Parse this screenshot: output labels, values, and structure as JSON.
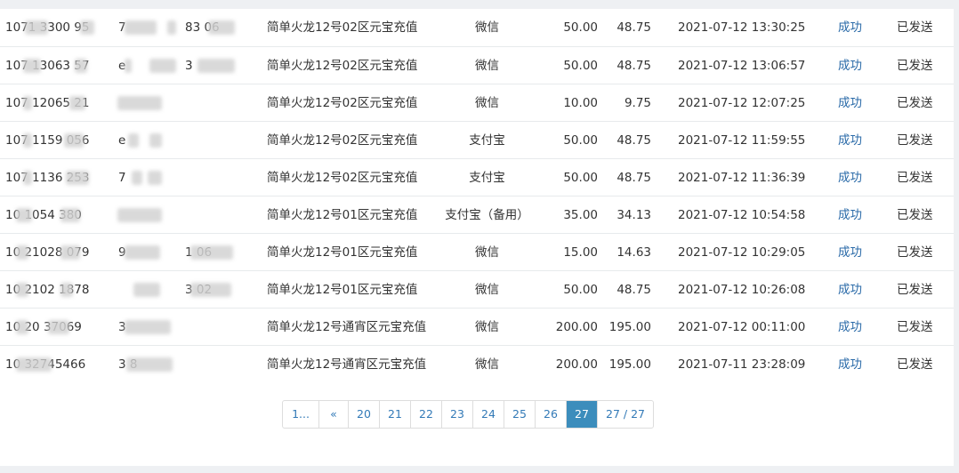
{
  "rows": [
    {
      "order": "1071 3300 95",
      "account": "7",
      "role": "83 06",
      "product": "简单火龙12号02区元宝充值",
      "payment": "微信",
      "amount": "50.00",
      "actual": "48.75",
      "time": "2021-07-12 13:30:25",
      "status": "成功",
      "delivery": "已发送"
    },
    {
      "order": "107 13063 57",
      "account": "e",
      "role": "3",
      "product": "简单火龙12号02区元宝充值",
      "payment": "微信",
      "amount": "50.00",
      "actual": "48.75",
      "time": "2021-07-12 13:06:57",
      "status": "成功",
      "delivery": "已发送"
    },
    {
      "order": "107 12065 21",
      "account": "",
      "role": "",
      "product": "简单火龙12号02区元宝充值",
      "payment": "微信",
      "amount": "10.00",
      "actual": "9.75",
      "time": "2021-07-12 12:07:25",
      "status": "成功",
      "delivery": "已发送"
    },
    {
      "order": "107 1159 056",
      "account": "e",
      "role": "",
      "product": "简单火龙12号02区元宝充值",
      "payment": "支付宝",
      "amount": "50.00",
      "actual": "48.75",
      "time": "2021-07-12 11:59:55",
      "status": "成功",
      "delivery": "已发送"
    },
    {
      "order": "107 1136 253",
      "account": "7",
      "role": "",
      "product": "简单火龙12号02区元宝充值",
      "payment": "支付宝",
      "amount": "50.00",
      "actual": "48.75",
      "time": "2021-07-12 11:36:39",
      "status": "成功",
      "delivery": "已发送"
    },
    {
      "order": "10 1054 380",
      "account": "",
      "role": "",
      "product": "简单火龙12号01区元宝充值",
      "payment": "支付宝（备用）",
      "amount": "35.00",
      "actual": "34.13",
      "time": "2021-07-12 10:54:58",
      "status": "成功",
      "delivery": "已发送"
    },
    {
      "order": "10 21028 079",
      "account": "9",
      "role": "1 06",
      "product": "简单火龙12号01区元宝充值",
      "payment": "微信",
      "amount": "15.00",
      "actual": "14.63",
      "time": "2021-07-12 10:29:05",
      "status": "成功",
      "delivery": "已发送"
    },
    {
      "order": "10 2102 1878",
      "account": "",
      "role": "3 02",
      "product": "简单火龙12号01区元宝充值",
      "payment": "微信",
      "amount": "50.00",
      "actual": "48.75",
      "time": "2021-07-12 10:26:08",
      "status": "成功",
      "delivery": "已发送"
    },
    {
      "order": "10 20 37069",
      "account": "3",
      "role": "",
      "product": "简单火龙12号通宵区元宝充值",
      "payment": "微信",
      "amount": "200.00",
      "actual": "195.00",
      "time": "2021-07-12 00:11:00",
      "status": "成功",
      "delivery": "已发送"
    },
    {
      "order": "10 32745466",
      "account": "3 8",
      "role": "",
      "product": "简单火龙12号通宵区元宝充值",
      "payment": "微信",
      "amount": "200.00",
      "actual": "195.00",
      "time": "2021-07-11 23:28:09",
      "status": "成功",
      "delivery": "已发送"
    }
  ],
  "pagination": {
    "pages": [
      "1...",
      "«",
      "20",
      "21",
      "22",
      "23",
      "24",
      "25",
      "26",
      "27",
      "27 / 27"
    ],
    "active": "27"
  },
  "colors": {
    "accent": "#3c8dbc",
    "status": "#2a6aa8",
    "link": "#337ab7"
  }
}
